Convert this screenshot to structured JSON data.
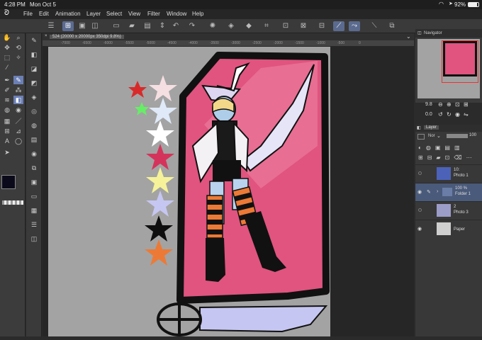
{
  "status": {
    "time": "4:28 PM",
    "date": "Mon Oct 5",
    "battery": "92%"
  },
  "menu": [
    "File",
    "Edit",
    "Animation",
    "Layer",
    "Select",
    "View",
    "Filter",
    "Window",
    "Help"
  ],
  "canvas_tab": "524 (20000 x 20000px 350dpi 9.8%)",
  "ruler_ticks": [
    "-7000",
    "-6500",
    "-6000",
    "-5500",
    "-5000",
    "-4500",
    "-4000",
    "-3500",
    "-3000",
    "-2500",
    "-2000",
    "-1500",
    "-1000",
    "-500",
    "0"
  ],
  "navigator": {
    "title": "Navigator",
    "zoom": "9.8",
    "angle": "0.0"
  },
  "layer_panel": {
    "tab": "Layer",
    "blend_mode": "Nor",
    "opacity": "100",
    "layers": [
      {
        "opacity": "10:",
        "name": "Photo 1"
      },
      {
        "opacity": "100 %",
        "name": "Folder 1"
      },
      {
        "opacity": "2",
        "name": "Photo 3"
      },
      {
        "opacity": "",
        "name": "Paper"
      }
    ]
  },
  "colors": {
    "pink": "#e0547f",
    "accent": "#6b7fb5",
    "main_color": "#0a0a1a",
    "sub_color": "#ffffff"
  },
  "icons": {
    "toolbox": [
      "hand-icon",
      "zoom-icon",
      "move-icon",
      "rotate-icon",
      "selection-icon",
      "magic-wand-icon",
      "eyedropper-icon",
      "pen-icon",
      "pencil-icon",
      "brush-icon",
      "airbrush-icon",
      "decoration-icon",
      "eraser-icon",
      "blend-icon",
      "fill-icon",
      "gradient-icon",
      "figure-icon",
      "frame-icon",
      "text-icon",
      "balloon-icon",
      "operation-icon"
    ],
    "subtool": [
      "subtool-1",
      "subtool-2",
      "subtool-3",
      "subtool-4",
      "subtool-5",
      "subtool-6",
      "subtool-7",
      "subtool-8",
      "subtool-9",
      "subtool-10",
      "subtool-11",
      "subtool-12",
      "subtool-13",
      "subtool-14",
      "subtool-15"
    ]
  }
}
